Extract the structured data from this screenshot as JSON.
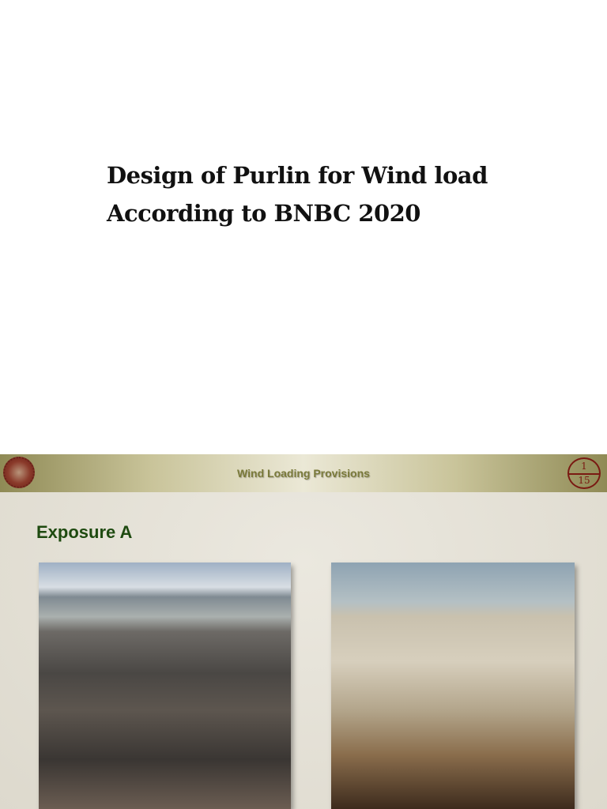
{
  "title_page": {
    "title_line1": "Design of Purlin for Wind load",
    "title_line2": "According to BNBC 2020"
  },
  "slide": {
    "banner_title": "Wind Loading Provisions",
    "page_current": "1",
    "page_total": "15",
    "heading": "Exposure A",
    "colors": {
      "heading": "#1e4a10",
      "pager": "#7a1a12"
    }
  }
}
